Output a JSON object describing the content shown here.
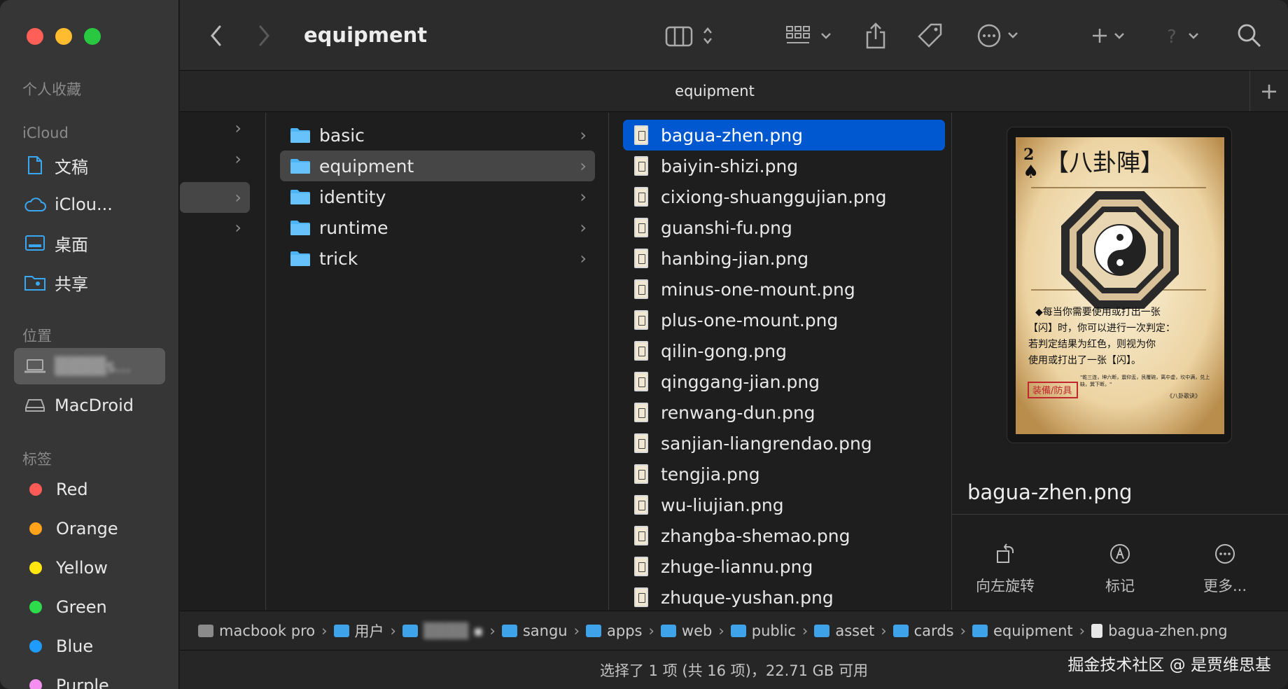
{
  "toolbar": {
    "title": "equipment"
  },
  "tab": {
    "label": "equipment",
    "add": "+"
  },
  "sidebar": {
    "favorites_title": "个人收藏",
    "icloud_title": "iCloud",
    "icloud_items": [
      {
        "label": "文稿",
        "icon": "document-icon"
      },
      {
        "label": "iClou...",
        "icon": "cloud-icon"
      },
      {
        "label": "桌面",
        "icon": "desktop-icon"
      },
      {
        "label": "共享",
        "icon": "shared-folder-icon"
      }
    ],
    "locations_title": "位置",
    "locations": [
      {
        "label": "▒▒▒▒s...",
        "icon": "laptop-icon"
      },
      {
        "label": "MacDroid",
        "icon": "drive-icon"
      }
    ],
    "tags_title": "标签",
    "tags": [
      {
        "label": "Red",
        "color": "#ff5b56"
      },
      {
        "label": "Orange",
        "color": "#ffa31a"
      },
      {
        "label": "Yellow",
        "color": "#ffe60f"
      },
      {
        "label": "Green",
        "color": "#2ddc4b"
      },
      {
        "label": "Blue",
        "color": "#1f9bff"
      },
      {
        "label": "Purple",
        "color": "#f48ff0"
      }
    ]
  },
  "columns": {
    "folders": [
      {
        "label": "basic"
      },
      {
        "label": "equipment"
      },
      {
        "label": "identity"
      },
      {
        "label": "runtime"
      },
      {
        "label": "trick"
      }
    ],
    "files": [
      {
        "label": "bagua-zhen.png"
      },
      {
        "label": "baiyin-shizi.png"
      },
      {
        "label": "cixiong-shuanggujian.png"
      },
      {
        "label": "guanshi-fu.png"
      },
      {
        "label": "hanbing-jian.png"
      },
      {
        "label": "minus-one-mount.png"
      },
      {
        "label": "plus-one-mount.png"
      },
      {
        "label": "qilin-gong.png"
      },
      {
        "label": "qinggang-jian.png"
      },
      {
        "label": "renwang-dun.png"
      },
      {
        "label": "sanjian-liangrendao.png"
      },
      {
        "label": "tengjia.png"
      },
      {
        "label": "wu-liujian.png"
      },
      {
        "label": "zhangba-shemao.png"
      },
      {
        "label": "zhuge-liannu.png"
      },
      {
        "label": "zhuque-yushan.png"
      }
    ]
  },
  "preview": {
    "filename": "bagua-zhen.png",
    "card": {
      "rank": "2",
      "suit": "♠",
      "title": "【八卦陣】",
      "text_lines": [
        "◆每当你需要使用或打出一张",
        "【闪】时，你可以进行一次判定：",
        "若判定结果为红色，则视为你",
        "使用或打出了一张【闪】。"
      ],
      "poem": "\"乾三连，坤六断，震仰盂，艮覆碗，离中虚，坎中满，兑上缺，巽下断。\"",
      "poem_source": "《八卦歌诀》",
      "type_stamp": "装備/防具"
    },
    "actions": [
      {
        "label": "向左旋转",
        "icon": "rotate-left-icon"
      },
      {
        "label": "标记",
        "icon": "markup-icon"
      },
      {
        "label": "更多...",
        "icon": "more-icon"
      }
    ]
  },
  "pathbar": [
    {
      "label": "macbook pro",
      "icon": "drive-icon"
    },
    {
      "label": "用户",
      "icon": "folder-icon"
    },
    {
      "label": "▒▒▒▒ ▪",
      "icon": "home-folder-icon"
    },
    {
      "label": "sangu",
      "icon": "folder-icon"
    },
    {
      "label": "apps",
      "icon": "folder-icon"
    },
    {
      "label": "web",
      "icon": "folder-icon"
    },
    {
      "label": "public",
      "icon": "folder-icon"
    },
    {
      "label": "asset",
      "icon": "folder-icon"
    },
    {
      "label": "cards",
      "icon": "folder-icon"
    },
    {
      "label": "equipment",
      "icon": "folder-icon"
    },
    {
      "label": "bagua-zhen.png",
      "icon": "file-icon"
    }
  ],
  "status": "选择了 1 项 (共 16 项)，22.71 GB 可用",
  "watermark": "掘金技术社区 @ 是贾维思基"
}
